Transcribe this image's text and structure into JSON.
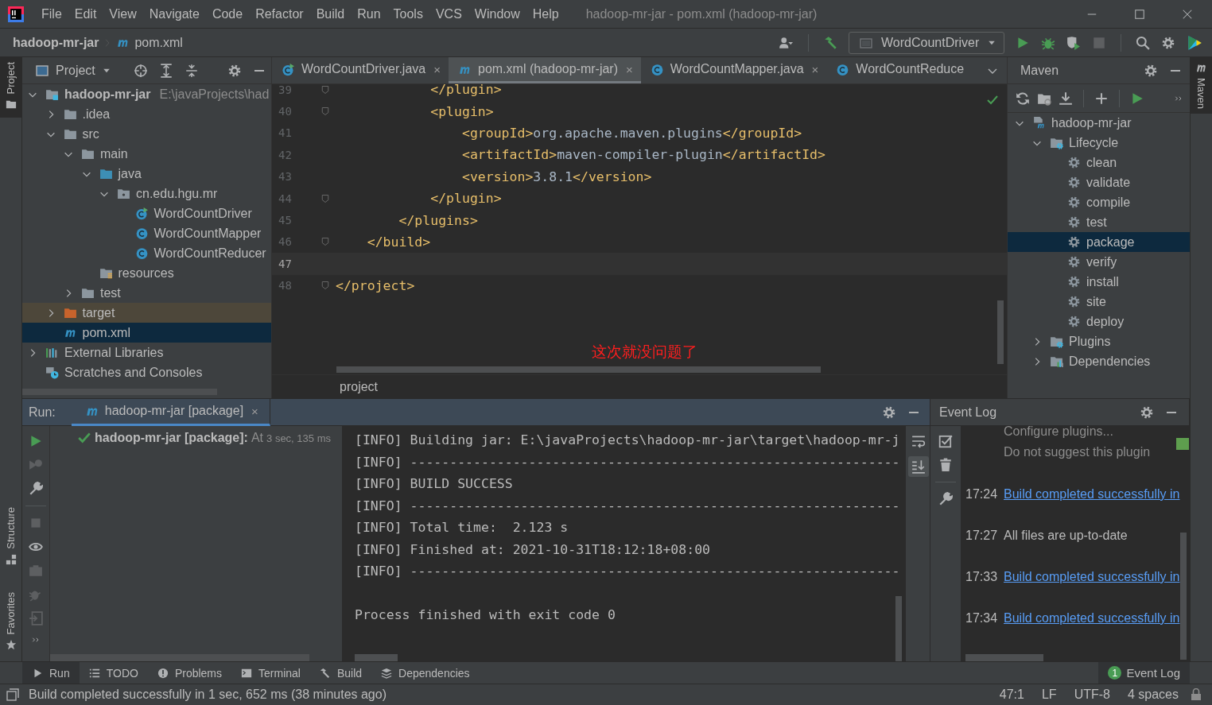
{
  "window": {
    "title": "hadoop-mr-jar - pom.xml (hadoop-mr-jar)"
  },
  "menu": [
    "File",
    "Edit",
    "View",
    "Navigate",
    "Code",
    "Refactor",
    "Build",
    "Run",
    "Tools",
    "VCS",
    "Window",
    "Help"
  ],
  "breadcrumb": [
    {
      "label": "hadoop-mr-jar",
      "kind": "project"
    },
    {
      "label": "pom.xml",
      "kind": "maven-file"
    }
  ],
  "run_configuration": {
    "label": "WordCountDriver"
  },
  "side_tabs": {
    "left": [
      {
        "label": "Project",
        "kind": "project",
        "selected": true
      },
      {
        "label": "Structure",
        "kind": "structure",
        "selected": false
      },
      {
        "label": "Favorites",
        "kind": "favorites",
        "selected": false
      }
    ],
    "right": [
      {
        "label": "Maven",
        "kind": "maven",
        "selected": true
      }
    ]
  },
  "project_panel": {
    "title": "Project",
    "tree": [
      {
        "label": "hadoop-mr-jar",
        "detail": "E:\\javaProjects\\had",
        "kind": "module",
        "expanded": true,
        "selected": false,
        "children": [
          {
            "label": ".idea",
            "kind": "folder",
            "expanded": false,
            "selected": false
          },
          {
            "label": "src",
            "kind": "folder",
            "expanded": true,
            "selected": false,
            "children": [
              {
                "label": "main",
                "kind": "folder",
                "expanded": true,
                "selected": false,
                "children": [
                  {
                    "label": "java",
                    "kind": "source-folder",
                    "expanded": true,
                    "selected": false,
                    "children": [
                      {
                        "label": "cn.edu.hgu.mr",
                        "kind": "package",
                        "expanded": true,
                        "selected": false,
                        "children": [
                          {
                            "label": "WordCountDriver",
                            "kind": "class-run",
                            "selected": false
                          },
                          {
                            "label": "WordCountMapper",
                            "kind": "class",
                            "selected": false
                          },
                          {
                            "label": "WordCountReducer",
                            "kind": "class",
                            "selected": false
                          }
                        ]
                      }
                    ]
                  },
                  {
                    "label": "resources",
                    "kind": "resources",
                    "selected": false
                  }
                ]
              },
              {
                "label": "test",
                "kind": "folder",
                "expanded": false,
                "selected": false
              }
            ]
          },
          {
            "label": "target",
            "kind": "excluded-folder",
            "expanded": false,
            "selected": false
          },
          {
            "label": "pom.xml",
            "kind": "maven-file",
            "selected": true
          }
        ]
      },
      {
        "label": "External Libraries",
        "kind": "libraries",
        "expanded": false,
        "selected": false
      },
      {
        "label": "Scratches and Consoles",
        "kind": "scratches",
        "selected": false
      }
    ]
  },
  "editor": {
    "tabs": [
      {
        "label": "WordCountDriver.java",
        "kind": "class-run",
        "selected": false,
        "close": "×"
      },
      {
        "label": "pom.xml (hadoop-mr-jar)",
        "kind": "maven-file",
        "selected": true,
        "close": "×"
      },
      {
        "label": "WordCountMapper.java",
        "kind": "class",
        "selected": false,
        "close": "×"
      },
      {
        "label": "WordCountReduce",
        "kind": "class",
        "selected": false
      }
    ],
    "lines": [
      {
        "number": "39",
        "text": "            </plugin>",
        "current": false,
        "fold": true
      },
      {
        "number": "40",
        "text": "            <plugin>",
        "current": false,
        "fold": true
      },
      {
        "number": "41",
        "text": "                <groupId>org.apache.maven.plugins</groupId>",
        "current": false,
        "fold": false
      },
      {
        "number": "42",
        "text": "                <artifactId>maven-compiler-plugin</artifactId>",
        "current": false,
        "fold": false
      },
      {
        "number": "43",
        "text": "                <version>3.8.1</version>",
        "current": false,
        "fold": false
      },
      {
        "number": "44",
        "text": "            </plugin>",
        "current": false,
        "fold": true
      },
      {
        "number": "45",
        "text": "        </plugins>",
        "current": false,
        "fold": false
      },
      {
        "number": "46",
        "text": "    </build>",
        "current": false,
        "fold": true
      },
      {
        "number": "47",
        "current": true,
        "fold": false
      },
      {
        "number": "48",
        "text": "</project>",
        "current": false,
        "fold": true
      }
    ],
    "annotation": "这次就没问题了",
    "breadcrumb": "project"
  },
  "maven": {
    "title": "Maven",
    "tree": [
      {
        "label": "hadoop-mr-jar",
        "kind": "maven-project",
        "expanded": true,
        "selected": false,
        "children": [
          {
            "label": "Lifecycle",
            "kind": "lifecycle",
            "expanded": true,
            "selected": false,
            "children": [
              {
                "label": "clean",
                "kind": "goal",
                "selected": false
              },
              {
                "label": "validate",
                "kind": "goal",
                "selected": false
              },
              {
                "label": "compile",
                "kind": "goal",
                "selected": false
              },
              {
                "label": "test",
                "kind": "goal",
                "selected": false
              },
              {
                "label": "package",
                "kind": "goal",
                "selected": true
              },
              {
                "label": "verify",
                "kind": "goal",
                "selected": false
              },
              {
                "label": "install",
                "kind": "goal",
                "selected": false
              },
              {
                "label": "site",
                "kind": "goal",
                "selected": false
              },
              {
                "label": "deploy",
                "kind": "goal",
                "selected": false
              }
            ]
          },
          {
            "label": "Plugins",
            "kind": "lifecycle",
            "expanded": false,
            "selected": false
          },
          {
            "label": "Dependencies",
            "kind": "dependencies",
            "expanded": false,
            "selected": false
          }
        ]
      }
    ]
  },
  "run": {
    "label": "Run:",
    "tab": {
      "label": "hadoop-mr-jar [package]",
      "close": "×",
      "selected": true
    },
    "tree": [
      {
        "label": "hadoop-mr-jar [package]:",
        "detail": "At",
        "duration": "3 sec, 135 ms",
        "kind": "success"
      }
    ],
    "console": [
      {
        "text": "[INFO] Building jar: E:\\javaProjects\\hadoop-mr-jar\\target\\hadoop-mr-j",
        "kind": "info"
      },
      {
        "text": "[INFO] --------------------------------------------------------------",
        "kind": "info"
      },
      {
        "text": "[INFO] BUILD SUCCESS",
        "kind": "info"
      },
      {
        "text": "[INFO] --------------------------------------------------------------",
        "kind": "info"
      },
      {
        "text": "[INFO] Total time:  2.123 s",
        "kind": "info"
      },
      {
        "text": "[INFO] Finished at: 2021-10-31T18:12:18+08:00",
        "kind": "info"
      },
      {
        "text": "[INFO] --------------------------------------------------------------",
        "kind": "info"
      },
      {
        "text": "Process finished with exit code 0",
        "kind": "exit"
      }
    ]
  },
  "event_log": {
    "title": "Event Log",
    "notification": [
      "Configure plugins...",
      "Do not suggest this plugin"
    ],
    "entries": [
      {
        "time": "17:24",
        "message": "Build completed successfully in",
        "kind": "link"
      },
      {
        "time": "17:27",
        "message": "All files are up-to-date",
        "kind": "text"
      },
      {
        "time": "17:33",
        "message": "Build completed successfully in",
        "kind": "link"
      },
      {
        "time": "17:34",
        "message": "Build completed successfully in",
        "kind": "link"
      }
    ]
  },
  "tool_tabs": [
    {
      "label": "Run",
      "kind": "run",
      "selected": true
    },
    {
      "label": "TODO",
      "kind": "todo",
      "selected": false
    },
    {
      "label": "Problems",
      "kind": "problems",
      "selected": false
    },
    {
      "label": "Terminal",
      "kind": "terminal",
      "selected": false
    },
    {
      "label": "Build",
      "kind": "build",
      "selected": false
    },
    {
      "label": "Dependencies",
      "kind": "dependencies",
      "selected": false
    }
  ],
  "event_log_tab": {
    "label": "Event Log",
    "badge": "1"
  },
  "status_bar": {
    "message": "Build completed successfully in 1 sec, 652 ms (38 minutes ago)",
    "items": [
      "47:1",
      "LF",
      "UTF-8",
      "4 spaces"
    ]
  }
}
